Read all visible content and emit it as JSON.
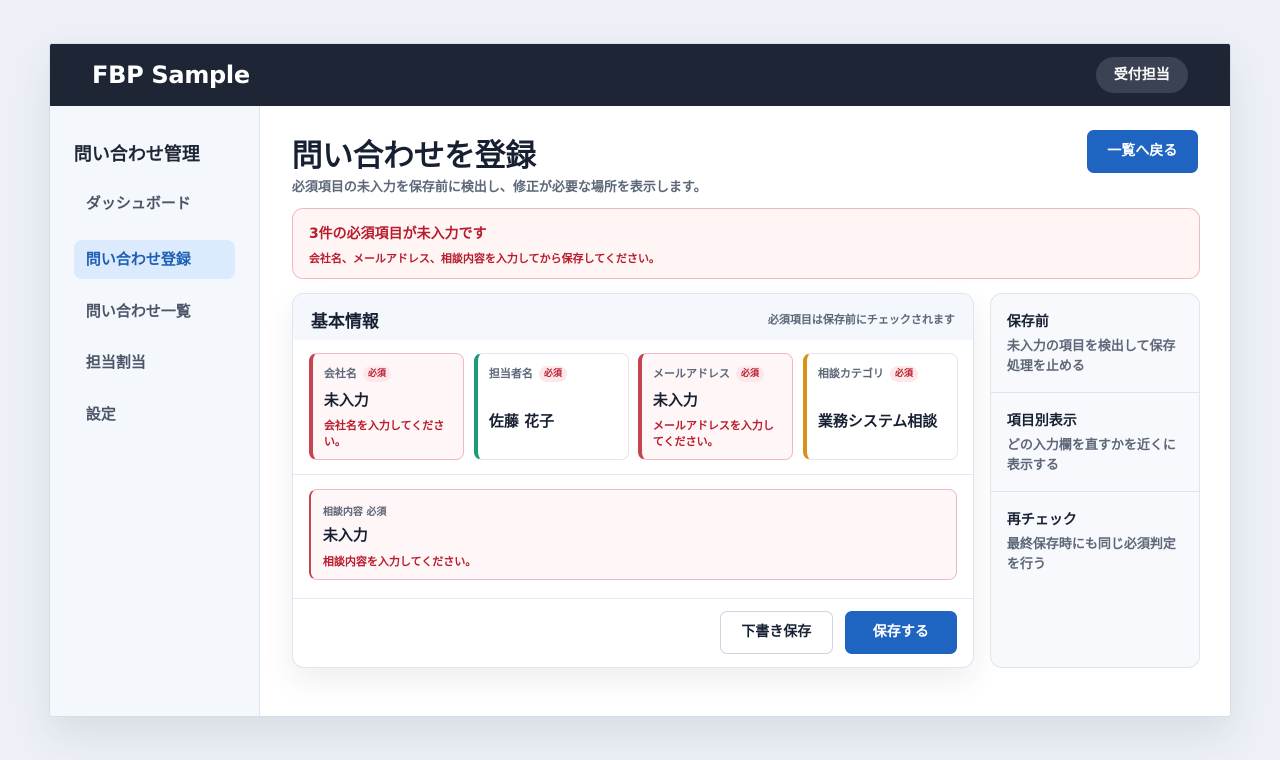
{
  "header": {
    "brand": "FBP Sample",
    "role": "受付担当"
  },
  "sidebar": {
    "title": "問い合わせ管理",
    "items": [
      {
        "label": "ダッシュボード",
        "active": false
      },
      {
        "label": "問い合わせ登録",
        "active": true
      },
      {
        "label": "問い合わせ一覧",
        "active": false
      },
      {
        "label": "担当割当",
        "active": false
      },
      {
        "label": "設定",
        "active": false
      }
    ]
  },
  "page": {
    "title": "問い合わせを登録",
    "subtitle": "必須項目の未入力を保存前に検出し、修正が必要な場所を表示します。",
    "back_button": "一覧へ戻る"
  },
  "alert": {
    "title": "3件の必須項目が未入力です",
    "message": "会社名、メールアドレス、相談内容を入力してから保存してください。"
  },
  "form": {
    "title": "基本情報",
    "note": "必須項目は保存前にチェックされます",
    "required_badge": "必須",
    "fields": [
      {
        "label": "会社名",
        "value": "未入力",
        "error": "会社名を入力してください。",
        "status": "error"
      },
      {
        "label": "担当者名",
        "value": "佐藤 花子",
        "error": "",
        "status": "ok"
      },
      {
        "label": "メールアドレス",
        "value": "未入力",
        "error": "メールアドレスを入力してください。",
        "status": "error"
      },
      {
        "label": "相談カテゴリ",
        "value": "業務システム相談",
        "error": "",
        "status": "warn"
      }
    ],
    "consultation": {
      "label": "相談内容 必須",
      "value": "未入力",
      "error": "相談内容を入力してください。"
    },
    "draft_button": "下書き保存",
    "save_button": "保存する"
  },
  "tips": [
    {
      "title": "保存前",
      "description": "未入力の項目を検出して保存処理を止める"
    },
    {
      "title": "項目別表示",
      "description": "どの入力欄を直すかを近くに表示する"
    },
    {
      "title": "再チェック",
      "description": "最終保存時にも同じ必須判定を行う"
    }
  ],
  "colors": {
    "topbar": "#1e2636",
    "primary": "#1f64c0",
    "error": "#b91c2c",
    "ok": "#1b9c79",
    "warning": "#d89219"
  }
}
